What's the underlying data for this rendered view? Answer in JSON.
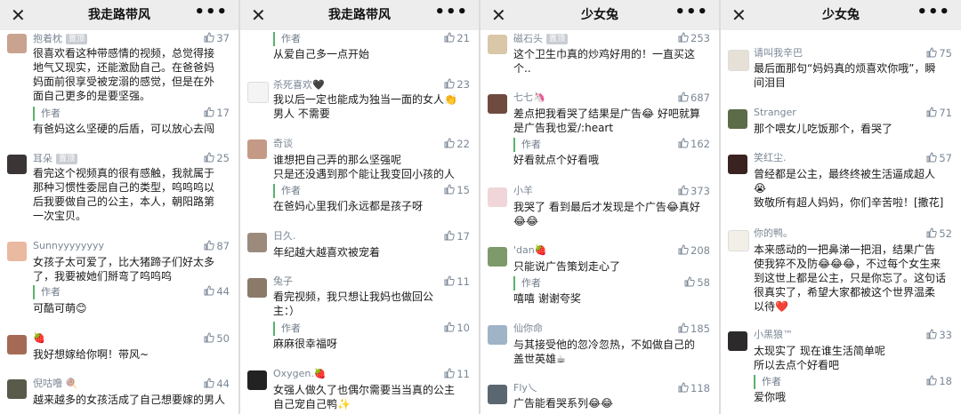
{
  "colors": {
    "accent_green": "#58b36a",
    "meta_gray": "#7b8796"
  },
  "icons": [
    "close-icon",
    "more-icon",
    "thumb-up-icon"
  ],
  "panels": [
    {
      "title": "我走路带风",
      "close": "✕",
      "more": "•••",
      "comments": [
        {
          "name": "抱着枕",
          "tag": "置顶",
          "like": "37",
          "lines": [
            "很喜欢看这种带感情的视频，总觉得接",
            "地气又现实，还能激励自己。在爸爸妈",
            "妈面前很享受被宠溺的感觉，但是在外",
            "面自己更多的是要坚强。"
          ],
          "reply": {
            "label": "作者",
            "like": "17",
            "text": "有爸妈这么坚硬的后盾，可以放心去闯"
          }
        },
        {
          "name": "耳朵",
          "tag": "置顶",
          "like": "25",
          "lines": [
            "看完这个视频真的很有感触，我就属于",
            "那种习惯性委屈自己的类型，呜呜呜以",
            "后我要做自己的公主，本人，朝阳路第",
            "一次宝贝。"
          ]
        },
        {
          "name": "Sunnyyyyyyyy",
          "like": "87",
          "lines": [
            "女孩子太可爱了，比大猪蹄子们好太多",
            "了，我要被她们掰弯了呜呜呜"
          ],
          "reply": {
            "label": "作者",
            "like": "44",
            "text": "可酷可萌😊"
          }
        },
        {
          "name": "🍓",
          "like": "50",
          "lines": [
            "我好想嫁给你啊！带风~"
          ]
        },
        {
          "name": "倪咕噜 🍭",
          "like": "44",
          "lines": [
            "越来越多的女孩活成了自己想要嫁的男人"
          ]
        }
      ]
    },
    {
      "title": "我走路带风",
      "close": "✕",
      "more": "•••",
      "comments": [
        {
          "name": "",
          "like": "",
          "lines": [],
          "reply": {
            "label": "作者",
            "like": "21",
            "text": "从爱自己多一点开始"
          }
        },
        {
          "name": "杀死喜欢🖤",
          "like": "23",
          "lines": [
            "我以后一定也能成为独当一面的女人👏",
            "男人 不需要"
          ]
        },
        {
          "name": "奇谈",
          "like": "22",
          "lines": [
            "谁想把自己弄的那么坚强呢",
            "只是还没遇到那个能让我变回小孩的人"
          ],
          "reply": {
            "label": "作者",
            "like": "15",
            "text": "在爸妈心里我们永远都是孩子呀"
          }
        },
        {
          "name": "日久.",
          "like": "17",
          "lines": [
            "年纪越大越喜欢被宠着"
          ]
        },
        {
          "name": "兔子",
          "like": "11",
          "lines": [
            "看完视频，我只想让我妈也做回公",
            "主：）"
          ],
          "reply": {
            "label": "作者",
            "like": "10",
            "text": "麻麻很幸福呀"
          }
        },
        {
          "name": "Oxygen.🍓",
          "like": "11",
          "lines": [
            "女强人做久了也偶尔需要当当真的公主",
            "自己宠自己鸭✨"
          ]
        }
      ]
    },
    {
      "title": "少女兔",
      "close": "✕",
      "more": "•••",
      "comments": [
        {
          "name": "磁石头",
          "tag": "置顶",
          "like": "253",
          "lines": [
            "这个卫生巾真的炒鸡好用的！一直买这",
            "个.."
          ]
        },
        {
          "name": "七七🦄",
          "like": "687",
          "lines": [
            "差点把我看哭了结果是广告😂 好吧就算",
            "是广告我也爱/:heart"
          ],
          "reply": {
            "label": "作者",
            "like": "162",
            "text": "好看就点个好看哦"
          }
        },
        {
          "name": "小羊",
          "like": "373",
          "lines": [
            "我哭了 看到最后才发现是个广告😂真好",
            "😂😂"
          ]
        },
        {
          "name": "'dan🍓",
          "like": "208",
          "lines": [
            "只能说广告策划走心了"
          ],
          "reply": {
            "label": "作者",
            "like": "58",
            "text": "嘻嘻 谢谢夸奖"
          }
        },
        {
          "name": "仙你命",
          "like": "185",
          "lines": [
            "与其接受他的忽冷忽热，不如做自己的",
            "盖世英雄☕"
          ]
        },
        {
          "name": "Fly乀",
          "like": "118",
          "lines": [
            "广告能看哭系列😂😂"
          ]
        }
      ]
    },
    {
      "title": "少女兔",
      "close": "✕",
      "more": "•••",
      "comments": [
        {
          "name": "请叫我辛巴",
          "like": "75",
          "lines": [
            "最后面那句“妈妈真的烦喜欢你哦”，瞬",
            "间泪目"
          ]
        },
        {
          "name": "Stranger",
          "like": "71",
          "lines": [
            "那个喂女儿吃饭那个，看哭了"
          ]
        },
        {
          "name": "笑红尘.",
          "like": "57",
          "lines": [
            "曾经都是公主，最终终被生活逼成超人",
            "😭",
            "致敬所有超人妈妈，你们辛苦啦！[撒花]"
          ]
        },
        {
          "name": "你的鸭。",
          "like": "52",
          "lines": [
            "本来感动的一把鼻涕一把泪，结果广告",
            "使我猝不及防😂😂😂，不过每个女生来",
            "到这世上都是公主，只是你忘了。这句话",
            "很真实了，希望大家都被这个世界温柔",
            "以待❤️"
          ]
        },
        {
          "name": "小黑狼™",
          "like": "33",
          "lines": [
            "太现实了 现在谁生活简单呢",
            "所以去点个好看吧"
          ],
          "reply": {
            "label": "作者",
            "like": "18",
            "text": "爱你哦"
          }
        }
      ]
    }
  ]
}
